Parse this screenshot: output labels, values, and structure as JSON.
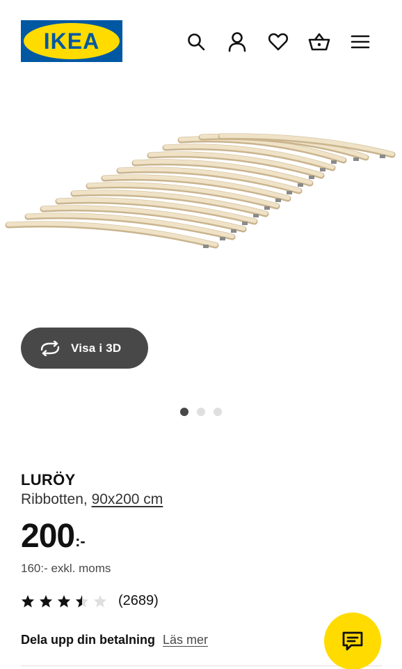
{
  "brand": {
    "logo_text": "IKEA",
    "blue": "#0058a3",
    "yellow": "#ffdb00"
  },
  "header": {
    "icons": [
      "search-icon",
      "account-icon",
      "favourites-icon",
      "cart-icon",
      "menu-icon"
    ]
  },
  "gallery": {
    "view_3d_label": "Visa i 3D",
    "view_3d_icon": "rotate-3d-icon",
    "image_count": 3,
    "active_image": 1
  },
  "product": {
    "name": "LURÖY",
    "type": "Ribbotten,",
    "size": "90x200 cm",
    "price": "200",
    "price_suffix": ":-",
    "price_excl_vat": "160:- exkl. moms",
    "rating": 3.5,
    "rating_max": 5,
    "review_count": "(2689)"
  },
  "payment": {
    "label": "Dela upp din betalning",
    "link": "Läs mer"
  },
  "chat": {
    "icon": "chat-icon"
  },
  "colors": {
    "dark_button": "#484848",
    "text": "#111111",
    "divider": "#dfdfdf"
  }
}
